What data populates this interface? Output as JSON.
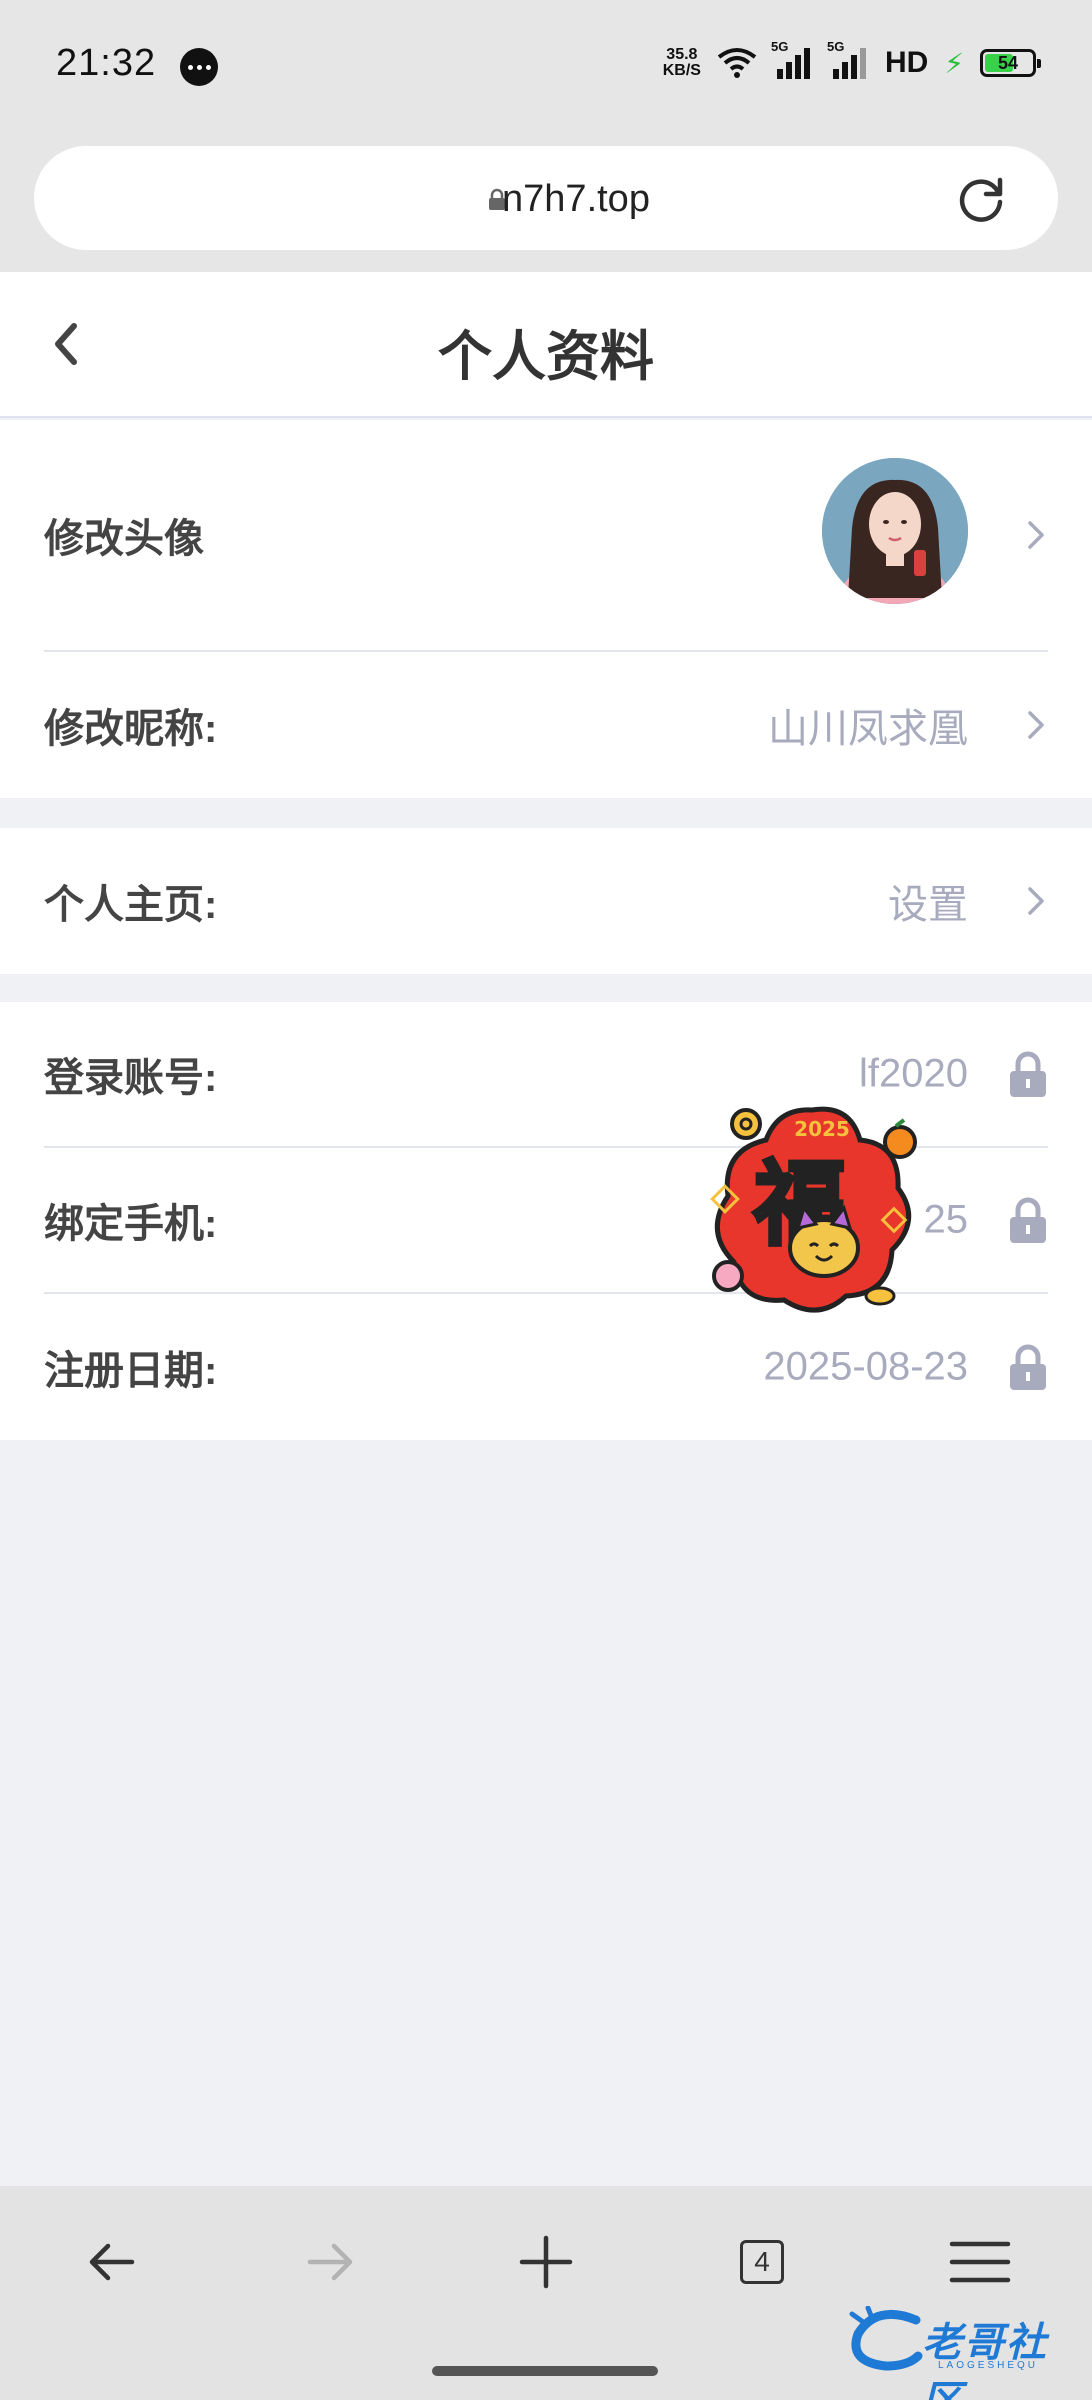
{
  "status_bar": {
    "time": "21:32",
    "network_speed_value": "35.8",
    "network_speed_unit": "KB/S",
    "signal_1_tag": "5G",
    "signal_2_tag": "5G",
    "hd_label": "HD",
    "battery_level": "54"
  },
  "browser": {
    "url": "n7h7.top",
    "open_tabs": "4"
  },
  "header": {
    "title": "个人资料"
  },
  "profile": {
    "avatar_label": "修改头像",
    "nickname_label": "修改昵称:",
    "nickname_value": "山川凤求凰",
    "homepage_label": "个人主页:",
    "homepage_value": "设置",
    "account_label": "登录账号:",
    "account_value": "lf2020",
    "phone_label": "绑定手机:",
    "phone_value": "25",
    "register_label": "注册日期:",
    "register_value": "2025-08-23"
  },
  "sticker": {
    "year": "2025",
    "character": "福"
  },
  "watermark": {
    "text": "老哥社区",
    "sub": "LAOGESHEQU"
  },
  "colors": {
    "accent_label": "#444444",
    "value_gray": "#a8abbd",
    "background": "#f0f1f5",
    "sticker_red": "#e8362c"
  }
}
